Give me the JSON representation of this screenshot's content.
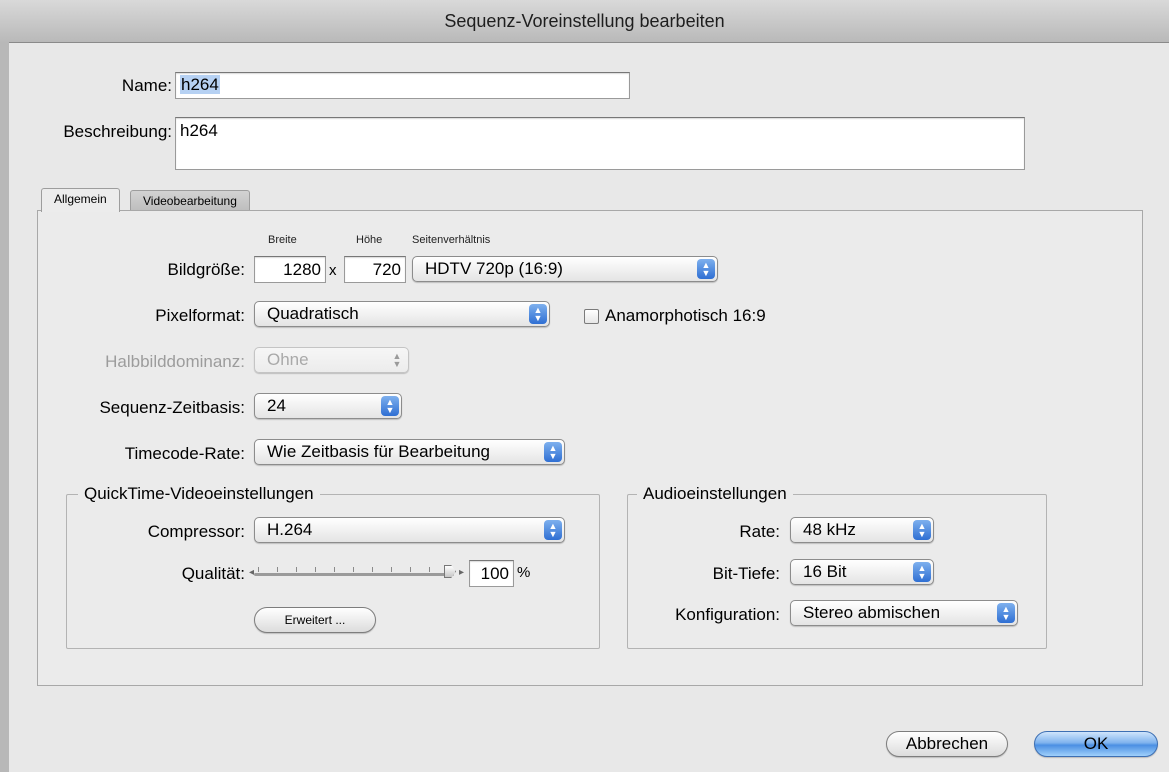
{
  "window": {
    "title": "Sequenz-Voreinstellung bearbeiten"
  },
  "name_field": {
    "label": "Name:",
    "value": "h264"
  },
  "description_field": {
    "label": "Beschreibung:",
    "value": "h264"
  },
  "tabs": [
    {
      "label": "Allgemein",
      "active": true
    },
    {
      "label": "Videobearbeitung",
      "active": false
    }
  ],
  "frame_size": {
    "label": "Bildgröße:",
    "width_caption": "Breite",
    "height_caption": "Höhe",
    "aspect_caption": "Seitenverhältnis",
    "width": "1280",
    "separator": "x",
    "height": "720",
    "aspect": "HDTV 720p (16:9)"
  },
  "pixel_aspect": {
    "label": "Pixelformat:",
    "value": "Quadratisch"
  },
  "anamorphic": {
    "label": "Anamorphotisch 16:9",
    "checked": false
  },
  "field_dominance": {
    "label": "Halbbilddominanz:",
    "value": "Ohne",
    "disabled": true
  },
  "editing_timebase": {
    "label": "Sequenz-Zeitbasis:",
    "value": "24"
  },
  "timecode_rate": {
    "label": "Timecode-Rate:",
    "value": "Wie Zeitbasis für Bearbeitung"
  },
  "quicktime": {
    "title": "QuickTime-Videoeinstellungen",
    "compressor_label": "Compressor:",
    "compressor": "H.264",
    "quality_label": "Qualität:",
    "quality_value": "100",
    "quality_unit": "%",
    "quality_fraction": 1.0,
    "advanced_button": "Erweitert ..."
  },
  "audio": {
    "title": "Audioeinstellungen",
    "rate_label": "Rate:",
    "rate": "48 kHz",
    "depth_label": "Bit-Tiefe:",
    "depth": "16 Bit",
    "config_label": "Konfiguration:",
    "config": "Stereo abmischen"
  },
  "buttons": {
    "cancel": "Abbrechen",
    "ok": "OK"
  },
  "colors": {
    "accent": "#4b8fe3",
    "selection": "#b6d1f3"
  }
}
